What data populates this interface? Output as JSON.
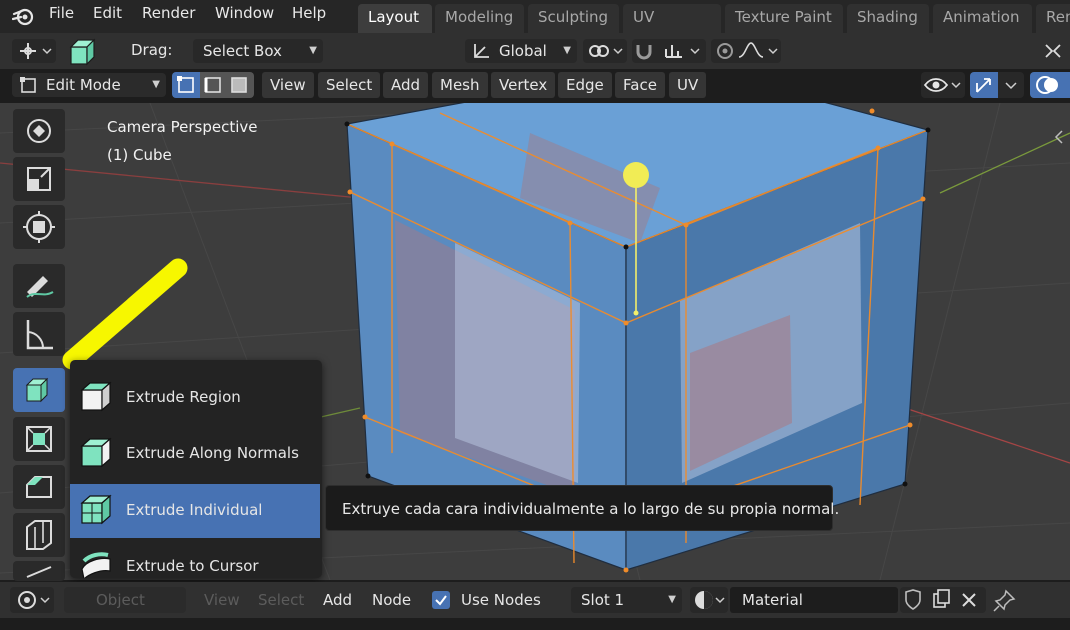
{
  "menubar": {
    "items": [
      "File",
      "Edit",
      "Render",
      "Window",
      "Help"
    ],
    "workspaces": [
      "Layout",
      "Modeling",
      "Sculpting",
      "UV Editing",
      "Texture Paint",
      "Shading",
      "Animation",
      "Ren"
    ],
    "active_workspace": "Layout"
  },
  "tool_header": {
    "drag_label": "Drag:",
    "drag_value": "Select Box",
    "orientation": "Global"
  },
  "viewport_header": {
    "mode": "Edit Mode",
    "menus": [
      "View",
      "Select",
      "Add",
      "Mesh",
      "Vertex",
      "Edge",
      "Face",
      "UV"
    ]
  },
  "viewport": {
    "view_name": "Camera Perspective",
    "object_name": "(1) Cube"
  },
  "toolbar": {
    "tools": [
      "transform-tool",
      "scale-tool",
      "transform-gizmo-tool",
      "annotate-tool",
      "measure-tool",
      "extrude-tool",
      "inset-tool",
      "bevel-tool",
      "loop-cut-tool",
      "knife-tool"
    ],
    "active_tool": "extrude-tool"
  },
  "flyout": {
    "items": [
      "Extrude Region",
      "Extrude Along Normals",
      "Extrude Individual",
      "Extrude to Cursor"
    ],
    "selected": "Extrude Individual",
    "accent": "#4772b3"
  },
  "tooltip": {
    "text": "Extruye cada cara individualmente a lo largo de su propia normal."
  },
  "shader_header": {
    "object_label": "Object",
    "view_label": "View",
    "select_label": "Select",
    "add_label": "Add",
    "node_label": "Node",
    "use_nodes_label": "Use Nodes",
    "use_nodes_checked": true,
    "slot": "Slot 1",
    "material": "Material"
  },
  "colors": {
    "highlighter": "#f7f700",
    "mesh_face": "#5c8ec4",
    "edge_selected": "#f08c2a",
    "active_blue": "#4772b3"
  }
}
